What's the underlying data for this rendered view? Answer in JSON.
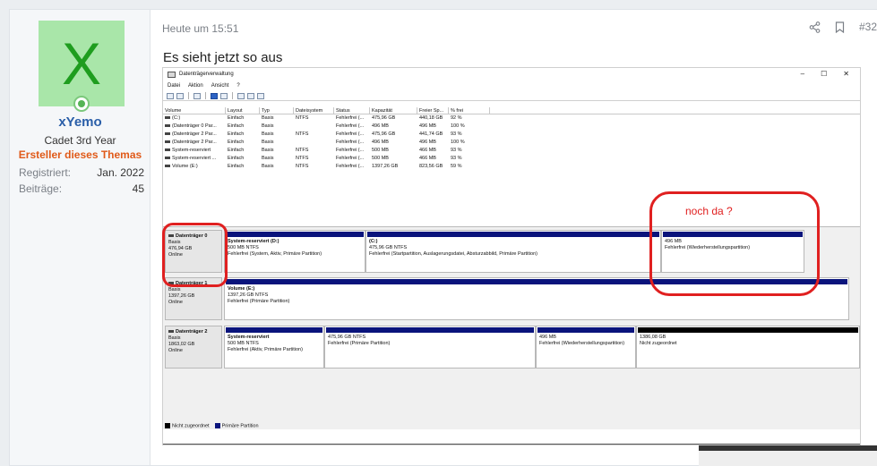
{
  "user": {
    "avatar_letter": "X",
    "name": "xYemo",
    "title": "Cadet 3rd Year",
    "banner": "Ersteller dieses Themas",
    "stats": [
      {
        "label": "Registriert:",
        "value": "Jan. 2022"
      },
      {
        "label": "Beiträge:",
        "value": "45"
      }
    ],
    "avatar_color": "#a9e6a9",
    "letter_color": "#1f9d1f"
  },
  "post": {
    "time": "Heute um 15:51",
    "number": "#32",
    "text": "Es sieht jetzt so aus",
    "icons": [
      "share-icon",
      "bookmark-icon"
    ]
  },
  "screenshot": {
    "title": "Datenträgerverwaltung",
    "controls": [
      "–",
      "☐",
      "✕"
    ],
    "menu": [
      "Datei",
      "Aktion",
      "Ansicht",
      "?"
    ],
    "columns": [
      "Volume",
      "Layout",
      "Typ",
      "Dateisystem",
      "Status",
      "Kapazität",
      "Freier Sp...",
      "% frei"
    ],
    "rows": [
      [
        "(C:)",
        "Einfach",
        "Basis",
        "NTFS",
        "Fehlerfrei (...",
        "475,96 GB",
        "440,18 GB",
        "92 %"
      ],
      [
        "(Datenträger 0 Par...",
        "Einfach",
        "Basis",
        "",
        "Fehlerfrei (...",
        "496 MB",
        "496 MB",
        "100 %"
      ],
      [
        "(Datenträger 2 Par...",
        "Einfach",
        "Basis",
        "NTFS",
        "Fehlerfrei (...",
        "475,96 GB",
        "441,74 GB",
        "93 %"
      ],
      [
        "(Datenträger 2 Par...",
        "Einfach",
        "Basis",
        "",
        "Fehlerfrei (...",
        "496 MB",
        "496 MB",
        "100 %"
      ],
      [
        "System-reserviert",
        "Einfach",
        "Basis",
        "NTFS",
        "Fehlerfrei (...",
        "500 MB",
        "466 MB",
        "93 %"
      ],
      [
        "System-reserviert ...",
        "Einfach",
        "Basis",
        "NTFS",
        "Fehlerfrei (...",
        "500 MB",
        "466 MB",
        "93 %"
      ],
      [
        "Volume (E:)",
        "Einfach",
        "Basis",
        "NTFS",
        "Fehlerfrei (...",
        "1397,26 GB",
        "823,56 GB",
        "59 %"
      ]
    ],
    "disks": [
      {
        "name": "Datenträger 0",
        "type": "Basis",
        "size": "476,94 GB",
        "state": "Online",
        "parts": [
          {
            "name": "System-reserviert  (D:)",
            "size": "500 MB NTFS",
            "status": "Fehlerfrei (System, Aktiv, Primäre Partition)"
          },
          {
            "name": "(C:)",
            "size": "475,96 GB NTFS",
            "status": "Fehlerfrei (Startpartition, Auslagerungsdatei, Absturzabbild, Primäre Partition)"
          },
          {
            "name": "",
            "size": "496 MB",
            "status": "Fehlerfrei (Wiederherstellungspartition)"
          }
        ]
      },
      {
        "name": "Datenträger 1",
        "type": "Basis",
        "size": "1397,26 GB",
        "state": "Online",
        "parts": [
          {
            "name": "Volume  (E:)",
            "size": "1397,26 GB NTFS",
            "status": "Fehlerfrei (Primäre Partition)"
          }
        ]
      },
      {
        "name": "Datenträger 2",
        "type": "Basis",
        "size": "1863,02 GB",
        "state": "Online",
        "parts": [
          {
            "name": "System-reserviert",
            "size": "500 MB NTFS",
            "status": "Fehlerfrei (Aktiv, Primäre Partition)"
          },
          {
            "name": "",
            "size": "475,96 GB NTFS",
            "status": "Fehlerfrei (Primäre Partition)"
          },
          {
            "name": "",
            "size": "496 MB",
            "status": "Fehlerfrei (Wiederherstellungspartition)"
          },
          {
            "name": "",
            "size": "1386,08 GB",
            "status": "Nicht zugeordnet"
          }
        ]
      }
    ],
    "legend": [
      "Nicht zugeordnet",
      "Primäre Partition"
    ],
    "annotation": "noch da ?",
    "annotation_color": "#e02020",
    "primary_color": "#0a147c"
  }
}
